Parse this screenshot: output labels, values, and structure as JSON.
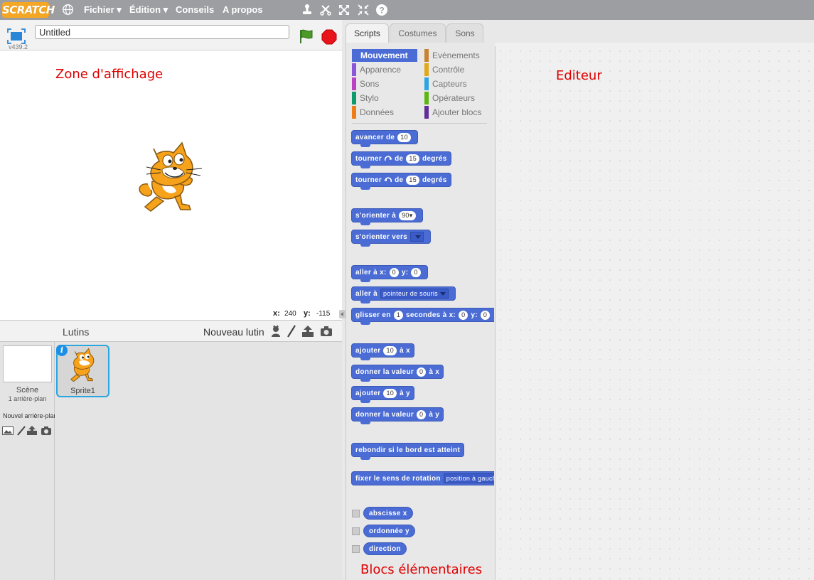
{
  "menubar": {
    "logo": "SCRATCH",
    "items": [
      "Fichier ▾",
      "Édition ▾",
      "Conseils",
      "A propos"
    ]
  },
  "stage": {
    "project_title": "Untitled",
    "version": "v439.2",
    "annotation": "Zone d'affichage",
    "coords": {
      "x_label": "x:",
      "x_value": "240",
      "y_label": "y:",
      "y_value": "-115"
    }
  },
  "sprites": {
    "scene_label": "Scène",
    "scene_sub": "1 arrière-plan",
    "new_backdrop_label": "Nouvel arrière-plan",
    "lutins_label": "Lutins",
    "new_sprite_label": "Nouveau lutin",
    "sprite_name": "Sprite1"
  },
  "tabs": [
    "Scripts",
    "Costumes",
    "Sons"
  ],
  "categories": [
    {
      "label": "Mouvement",
      "color": "#4a6cd4",
      "selected": true
    },
    {
      "label": "Evènements",
      "color": "#c88330"
    },
    {
      "label": "Apparence",
      "color": "#8a55d7"
    },
    {
      "label": "Contrôle",
      "color": "#e1a91a"
    },
    {
      "label": "Sons",
      "color": "#bb42c3"
    },
    {
      "label": "Capteurs",
      "color": "#2ca5e2"
    },
    {
      "label": "Stylo",
      "color": "#0e9a6c"
    },
    {
      "label": "Opérateurs",
      "color": "#5cb712"
    },
    {
      "label": "Données",
      "color": "#ee7d16"
    },
    {
      "label": "Ajouter blocs",
      "color": "#632d99"
    }
  ],
  "blocks": {
    "move": {
      "a": "avancer de",
      "n": "10"
    },
    "turn_right": {
      "a": "tourner",
      "b": "de",
      "n": "15",
      "c": "degrés"
    },
    "turn_left": {
      "a": "tourner",
      "b": "de",
      "n": "15",
      "c": "degrés"
    },
    "point_dir": {
      "a": "s'orienter à",
      "n": "90▾"
    },
    "point_towards": {
      "a": "s'orienter vers",
      "d": ""
    },
    "goto_xy": {
      "a": "aller à x:",
      "x": "0",
      "b": "y:",
      "y": "0"
    },
    "goto": {
      "a": "aller à",
      "d": "pointeur de souris"
    },
    "glide": {
      "a": "glisser en",
      "n": "1",
      "b": "secondes à x:",
      "x": "0",
      "c": "y:",
      "y": "0"
    },
    "change_x": {
      "a": "ajouter",
      "n": "10",
      "b": "à x"
    },
    "set_x": {
      "a": "donner la valeur",
      "n": "0",
      "b": "à x"
    },
    "change_y": {
      "a": "ajouter",
      "n": "10",
      "b": "à y"
    },
    "set_y": {
      "a": "donner la valeur",
      "n": "0",
      "b": "à y"
    },
    "bounce": {
      "a": "rebondir si le bord est atteint"
    },
    "rotation_style": {
      "a": "fixer le sens de rotation",
      "d": "position à gauche ou à droite"
    },
    "reporters": [
      "abscisse x",
      "ordonnée y",
      "direction"
    ]
  },
  "palette_annotation": "Blocs élémentaires",
  "editor_annotation": "Editeur",
  "colors": {
    "motion": "#4a6cd4",
    "annotation": "#e00000",
    "menubar": "#9c9ea2",
    "selection": "#27a6e0"
  }
}
